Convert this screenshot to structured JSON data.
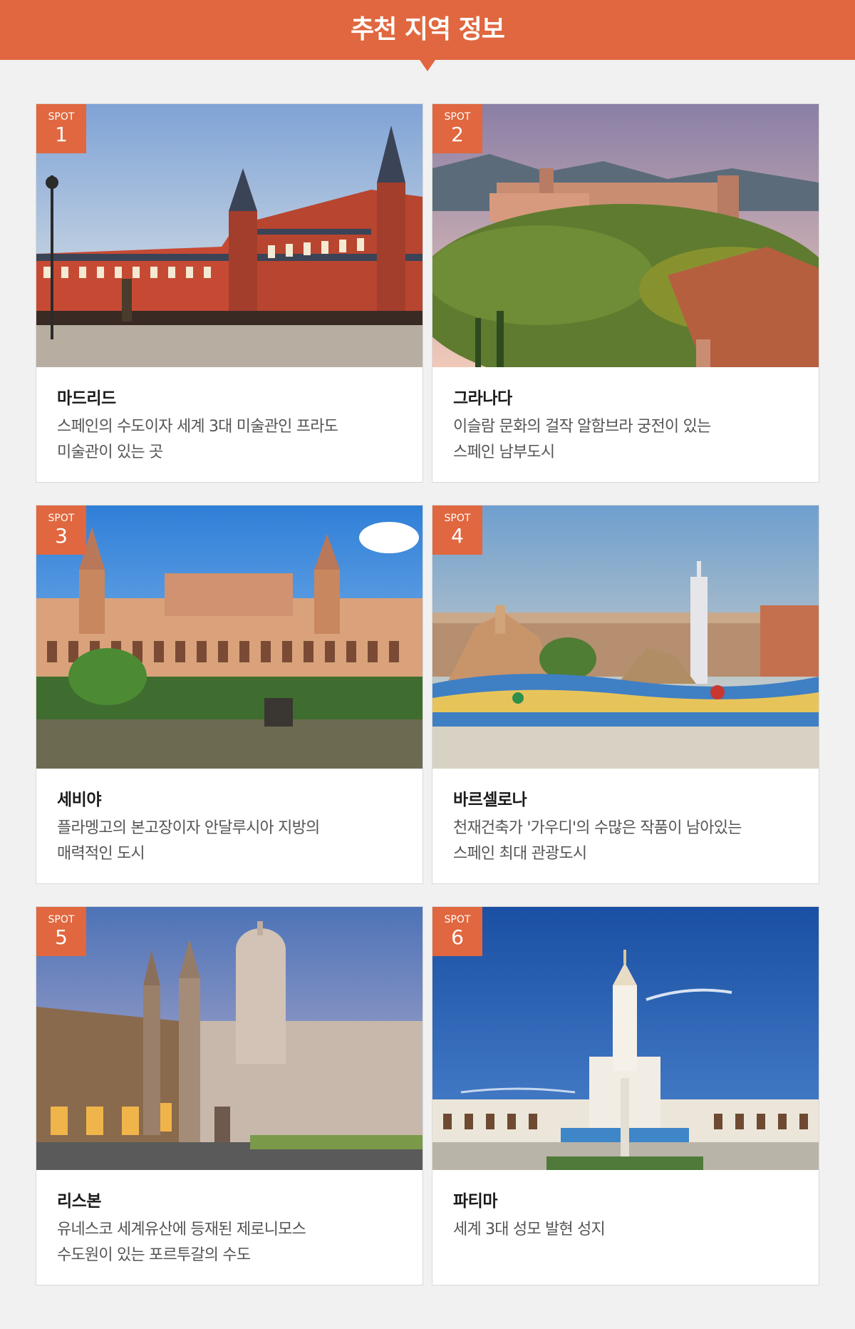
{
  "header": {
    "title": "추천 지역 정보"
  },
  "spots": [
    {
      "badge_label": "SPOT",
      "number": "1",
      "title": "마드리드",
      "desc": [
        "스페인의 수도이자 세계 3대 미술관인 프라도",
        "미술관이 있는 곳"
      ]
    },
    {
      "badge_label": "SPOT",
      "number": "2",
      "title": "그라나다",
      "desc": [
        "이슬람 문화의 걸작 알함브라 궁전이 있는",
        "스페인 남부도시"
      ]
    },
    {
      "badge_label": "SPOT",
      "number": "3",
      "title": "세비야",
      "desc": [
        "플라멩고의 본고장이자 안달루시아 지방의",
        "매력적인 도시"
      ]
    },
    {
      "badge_label": "SPOT",
      "number": "4",
      "title": "바르셀로나",
      "desc": [
        "천재건축가 '가우디'의 수많은 작품이 남아있는",
        "스페인 최대 관광도시"
      ]
    },
    {
      "badge_label": "SPOT",
      "number": "5",
      "title": "리스본",
      "desc": [
        "유네스코 세계유산에 등재된 제로니모스",
        "수도원이 있는 포르투갈의 수도"
      ]
    },
    {
      "badge_label": "SPOT",
      "number": "6",
      "title": "파티마",
      "desc": [
        "세계 3대 성모 발현 성지",
        ""
      ]
    }
  ],
  "colors": {
    "accent": "#e0673f",
    "background": "#f1f1f1",
    "card": "#ffffff"
  }
}
